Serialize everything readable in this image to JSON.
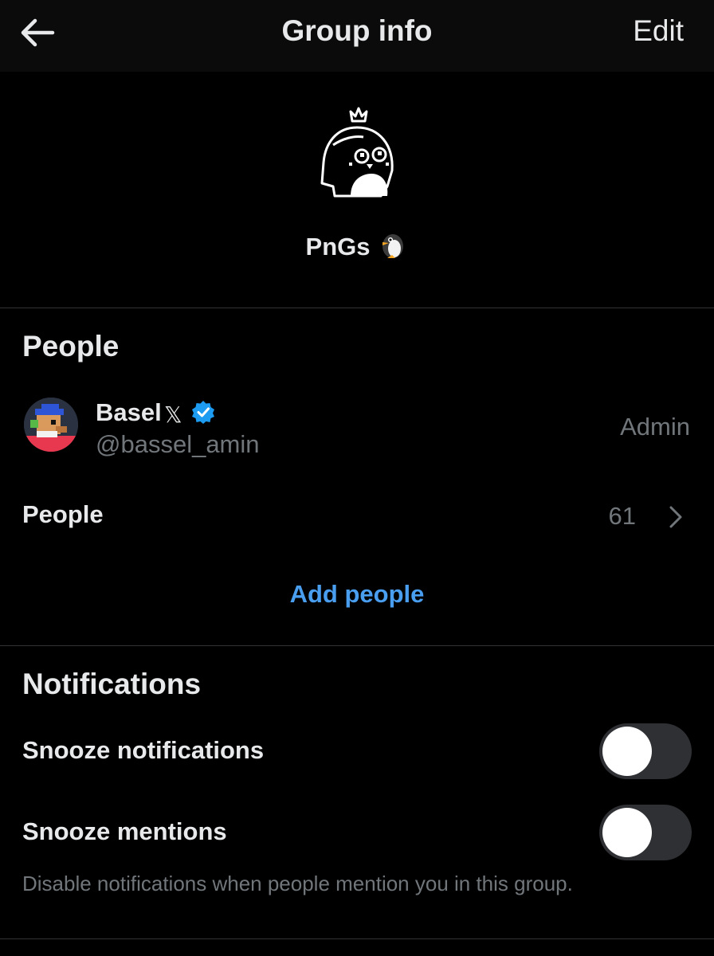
{
  "header": {
    "title": "Group info",
    "edit_label": "Edit",
    "back_icon": "arrow-left-icon"
  },
  "group": {
    "name": "PnGs",
    "emoji_icon": "penguin-icon",
    "avatar_icon": "penguin-pixel-avatar-icon"
  },
  "people_section": {
    "title": "People",
    "member": {
      "name": "Basel",
      "badge_icons": [
        "x-logo-icon",
        "verified-check-icon"
      ],
      "handle": "@bassel_amin",
      "role": "Admin"
    },
    "people_row": {
      "label": "People",
      "count": "61"
    },
    "add_people_label": "Add people"
  },
  "notifications_section": {
    "title": "Notifications",
    "snooze_notifications": {
      "label": "Snooze notifications",
      "enabled": false
    },
    "snooze_mentions": {
      "label": "Snooze mentions",
      "enabled": false
    },
    "hint": "Disable notifications when people mention you in this group."
  },
  "colors": {
    "background": "#000000",
    "header_background": "#0b0b0b",
    "text_primary": "#e7e9ea",
    "text_secondary": "#71767b",
    "accent": "#4a9eef",
    "verified": "#1d9bf0",
    "toggle_track": "#2f3034",
    "divider": "#2f3336"
  }
}
